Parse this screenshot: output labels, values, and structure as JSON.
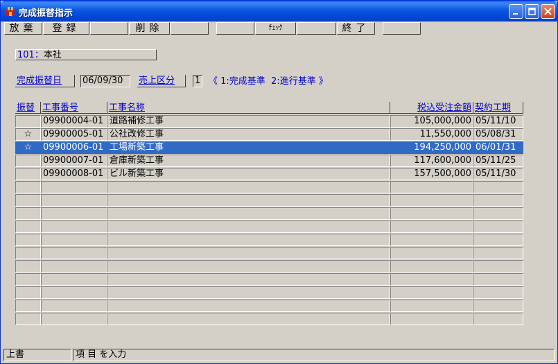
{
  "window": {
    "title": "完成振替指示"
  },
  "toolbar": {
    "keys": [
      "放棄",
      "登録",
      "",
      "削除",
      "",
      "",
      "ﾁｪｯｸ",
      "",
      "終了",
      ""
    ]
  },
  "branch": {
    "code": "101",
    "sep": "：",
    "name": "本社"
  },
  "filter": {
    "date_label": "完成振替日",
    "date_value": "06/09/30",
    "sales_label": "売上区分",
    "sales_value": "1",
    "hint": "《 1:完成基準  2:進行基準 》"
  },
  "table": {
    "headers": [
      "振替",
      "工事番号",
      "工事名称",
      "税込受注金額",
      "契約工期"
    ],
    "rows": [
      {
        "mark": "",
        "number": "09900004-01",
        "name": "道路補修工事",
        "amount": "105,000,000",
        "term": "05/11/10",
        "selected": false
      },
      {
        "mark": "☆",
        "number": "09900005-01",
        "name": "公社改修工事",
        "amount": "11,550,000",
        "term": "05/08/31",
        "selected": false
      },
      {
        "mark": "☆",
        "number": "09900006-01",
        "name": "工場新築工事",
        "amount": "194,250,000",
        "term": "06/01/31",
        "selected": true
      },
      {
        "mark": "",
        "number": "09900007-01",
        "name": "倉庫新築工事",
        "amount": "117,600,000",
        "term": "05/11/25",
        "selected": false
      },
      {
        "mark": "",
        "number": "09900008-01",
        "name": "ビル新築工事",
        "amount": "157,500,000",
        "term": "05/11/30",
        "selected": false
      },
      {
        "mark": "",
        "number": "",
        "name": "",
        "amount": "",
        "term": "",
        "selected": false
      },
      {
        "mark": "",
        "number": "",
        "name": "",
        "amount": "",
        "term": "",
        "selected": false
      },
      {
        "mark": "",
        "number": "",
        "name": "",
        "amount": "",
        "term": "",
        "selected": false
      },
      {
        "mark": "",
        "number": "",
        "name": "",
        "amount": "",
        "term": "",
        "selected": false
      },
      {
        "mark": "",
        "number": "",
        "name": "",
        "amount": "",
        "term": "",
        "selected": false
      },
      {
        "mark": "",
        "number": "",
        "name": "",
        "amount": "",
        "term": "",
        "selected": false
      },
      {
        "mark": "",
        "number": "",
        "name": "",
        "amount": "",
        "term": "",
        "selected": false
      },
      {
        "mark": "",
        "number": "",
        "name": "",
        "amount": "",
        "term": "",
        "selected": false
      },
      {
        "mark": "",
        "number": "",
        "name": "",
        "amount": "",
        "term": "",
        "selected": false
      },
      {
        "mark": "",
        "number": "",
        "name": "",
        "amount": "",
        "term": "",
        "selected": false
      },
      {
        "mark": "",
        "number": "",
        "name": "",
        "amount": "",
        "term": "",
        "selected": false
      }
    ]
  },
  "status": {
    "mode": "上書",
    "message": "項 目 を入力"
  },
  "colors": {
    "title_bar": "#0054e3",
    "selection": "#316ac5",
    "link": "#0000cc",
    "face": "#d4d0c8"
  }
}
